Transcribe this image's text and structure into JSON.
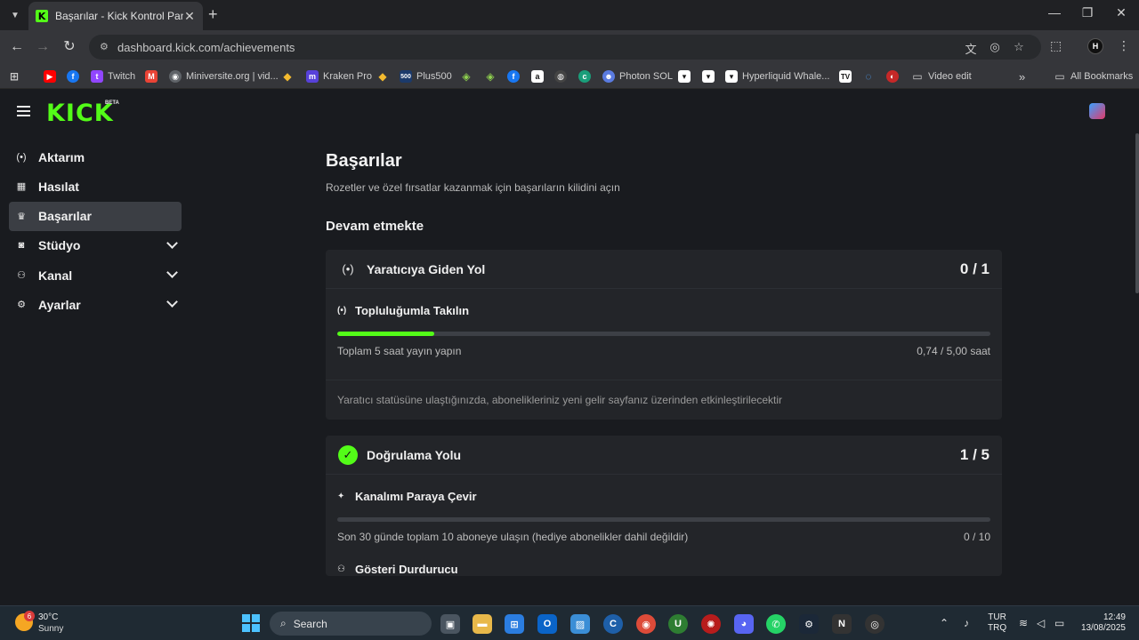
{
  "browser": {
    "tab_title": "Başarılar - Kick Kontrol Paneli",
    "tab_favicon": "K",
    "url": "dashboard.kick.com/achievements",
    "profile_initial": "H",
    "all_bookmarks_label": "All Bookmarks",
    "bookmarks": {
      "twitch": "Twitch",
      "miniversite": "Miniversite.org | vid...",
      "kraken": "Kraken Pro",
      "plus500": "Plus500",
      "photon": "Photon SOL",
      "hyperliquid": "Hyperliquid Whale...",
      "video_edit": "Video edit"
    }
  },
  "kick": {
    "logo": "KICK",
    "beta": "BETA",
    "sidebar": {
      "items": [
        {
          "label": "Aktarım",
          "icon": "broadcast-icon"
        },
        {
          "label": "Hasılat",
          "icon": "chart-icon"
        },
        {
          "label": "Başarılar",
          "icon": "trophy-icon"
        },
        {
          "label": "Stüdyo",
          "icon": "camera-icon"
        },
        {
          "label": "Kanal",
          "icon": "users-icon"
        },
        {
          "label": "Ayarlar",
          "icon": "gear-icon"
        }
      ]
    },
    "main": {
      "title": "Başarılar",
      "subtitle": "Rozetler ve özel fırsatlar kazanmak için başarıların kilidini açın",
      "section": "Devam etmekte",
      "cards": [
        {
          "title": "Yaratıcıya Giden Yol",
          "count": "0 / 1",
          "task_title": "Topluluğumla Takılın",
          "task_desc": "Toplam 5 saat yayın yapın",
          "task_progress": "0,74 / 5,00 saat",
          "progress_fraction": 0.148,
          "note": "Yaratıcı statüsüne ulaştığınızda, abonelikleriniz yeni gelir sayfanız üzerinden etkinleştirilecektir"
        },
        {
          "title": "Doğrulama Yolu",
          "count": "1 / 5",
          "task_title": "Kanalımı Paraya Çevir",
          "task_desc": "Son 30 günde toplam 10 aboneye ulaşın (hediye abonelikler dahil değildir)",
          "task_progress": "0 / 10",
          "progress_fraction": 0,
          "task2_title": "Gösteri Durdurucu"
        }
      ]
    }
  },
  "taskbar": {
    "weather_temp": "30°C",
    "weather_desc": "Sunny",
    "weather_badge": "6",
    "search_label": "Search",
    "lang_top": "TUR",
    "lang_bottom": "TRQ",
    "time": "12:49",
    "date": "13/08/2025"
  },
  "colors": {
    "accent": "#53fc18",
    "background": "#191b1f",
    "card": "#232529"
  }
}
